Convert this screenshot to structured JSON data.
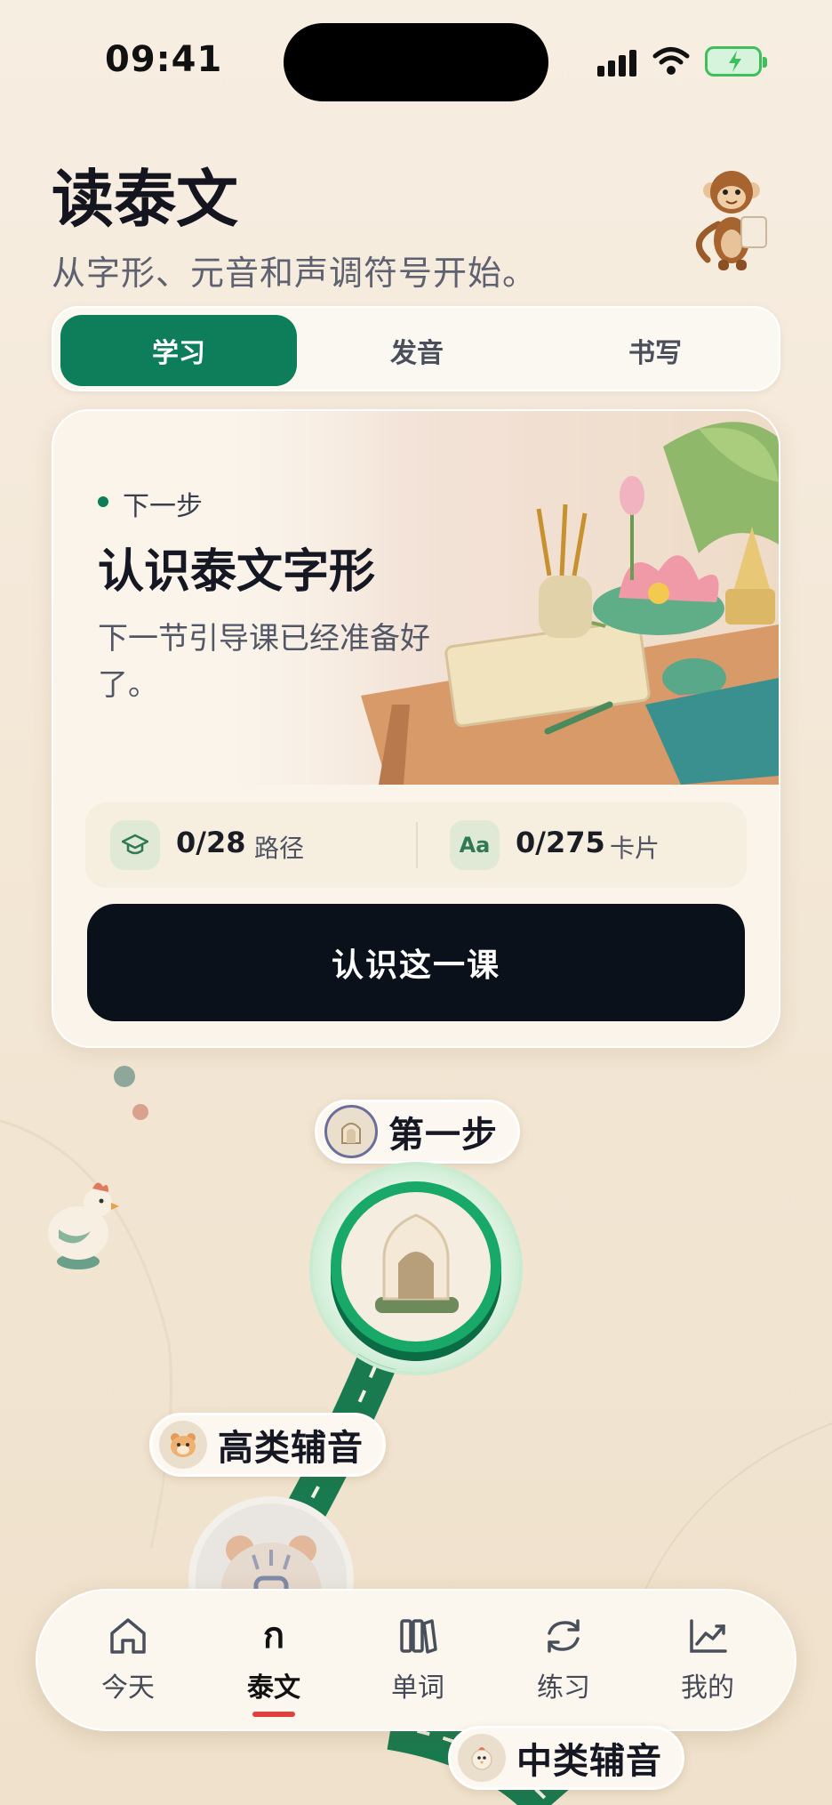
{
  "status_bar": {
    "time": "09:41"
  },
  "header": {
    "title": "读泰文",
    "subtitle": "从字形、元音和声调符号开始。"
  },
  "segments": [
    {
      "label": "学习",
      "active": true
    },
    {
      "label": "发音",
      "active": false
    },
    {
      "label": "书写",
      "active": false
    }
  ],
  "lesson_card": {
    "next_label": "下一步",
    "title": "认识泰文字形",
    "description": "下一节引导课已经准备好了。",
    "stats": [
      {
        "icon": "graduation-cap-icon",
        "value": "0/28",
        "label": "路径"
      },
      {
        "icon": "font-aa-icon",
        "icon_text": "Aa",
        "value": "0/275",
        "label": "卡片"
      }
    ],
    "cta_label": "认识这一课"
  },
  "path": {
    "stages": [
      {
        "label": "第一步",
        "icon": "arch-icon"
      },
      {
        "label": "高类辅音",
        "icon": "tiger-icon"
      },
      {
        "label": "中类辅音",
        "icon": "chicken-icon"
      }
    ]
  },
  "tab_bar": {
    "items": [
      {
        "label": "今天",
        "icon": "home-icon",
        "active": false
      },
      {
        "label": "泰文",
        "icon": "thai-letter-icon",
        "icon_text": "ก",
        "active": true
      },
      {
        "label": "单词",
        "icon": "books-icon",
        "active": false
      },
      {
        "label": "练习",
        "icon": "refresh-icon",
        "active": false
      },
      {
        "label": "我的",
        "icon": "chart-icon",
        "active": false
      }
    ]
  },
  "colors": {
    "accent": "#0e7d59",
    "cta": "#0b111a",
    "active_tab_indicator": "#e0413f"
  }
}
